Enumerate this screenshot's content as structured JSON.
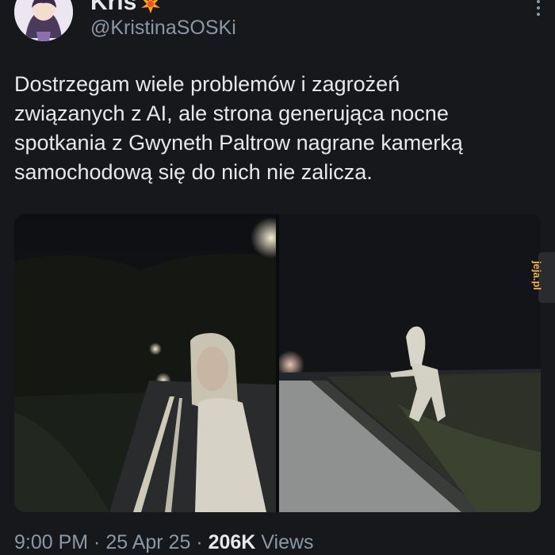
{
  "author": {
    "display_name": "Kris",
    "badge_icon": "sparkle-burst-icon",
    "handle": "@KristinaSOSKi"
  },
  "tweet": {
    "text": "Dostrzegam wiele problemów i zagrożeń\nzwiązanych z AI, ale strona generująca nocne\nspotkania z Gwyneth Paltrow nagrane kamerką\nsamochodową się do nich nie zalicza."
  },
  "media": {
    "images": [
      {
        "description_icon": "dashcam-photo-road-woman"
      },
      {
        "description_icon": "dashcam-photo-roadside-figure"
      }
    ]
  },
  "watermark": {
    "text": "jeja.pl",
    "color": "#f2b33d"
  },
  "meta": {
    "time": "9:00 PM",
    "separator": " · ",
    "date": "25 Apr 25",
    "views_count": "206K",
    "views_label": "Views"
  },
  "colors": {
    "background": "#16181c",
    "text": "#e7e9ea",
    "secondary": "#8b98a5"
  }
}
